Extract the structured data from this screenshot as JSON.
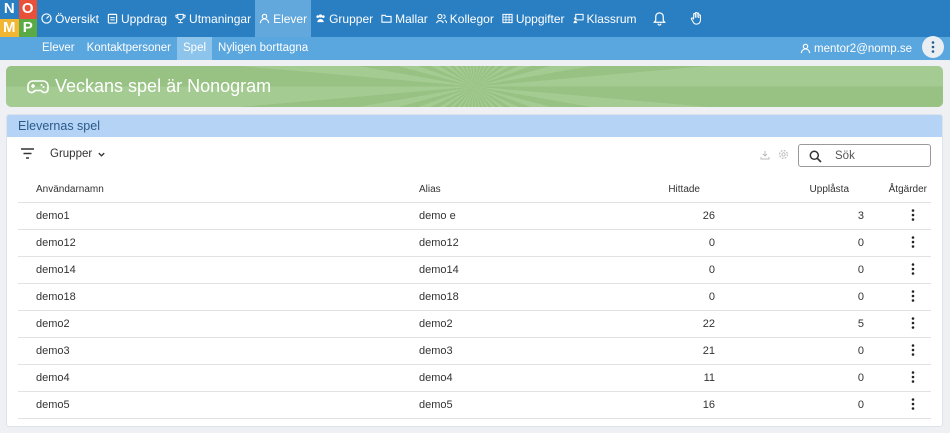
{
  "logo": {
    "letters": [
      "N",
      "O",
      "M",
      "P"
    ]
  },
  "nav": {
    "items": [
      {
        "label": "Översikt",
        "icon": "gauge-icon",
        "active": false
      },
      {
        "label": "Uppdrag",
        "icon": "clipboard-icon",
        "active": false
      },
      {
        "label": "Utmaningar",
        "icon": "trophy-icon",
        "active": false
      },
      {
        "label": "Elever",
        "icon": "user-icon",
        "active": true
      },
      {
        "label": "Grupper",
        "icon": "users-icon",
        "active": false
      },
      {
        "label": "Mallar",
        "icon": "folder-icon",
        "active": false
      },
      {
        "label": "Kollegor",
        "icon": "colleagues-icon",
        "active": false
      },
      {
        "label": "Uppgifter",
        "icon": "grid-icon",
        "active": false
      },
      {
        "label": "Klassrum",
        "icon": "classroom-icon",
        "active": false
      }
    ]
  },
  "subnav": {
    "items": [
      {
        "label": "Elever",
        "active": false
      },
      {
        "label": "Kontaktpersoner",
        "active": false
      },
      {
        "label": "Spel",
        "active": true
      },
      {
        "label": "Nyligen borttagna",
        "active": false
      }
    ],
    "user": "mentor2@nomp.se"
  },
  "banner": {
    "title": "Veckans spel är Nonogram"
  },
  "panel": {
    "title": "Elevernas spel",
    "groups_label": "Grupper",
    "search_placeholder": "Sök",
    "columns": {
      "username": "Användarnamn",
      "alias": "Alias",
      "found": "Hittade",
      "solved": "Upplåsta",
      "actions": "Åtgärder"
    },
    "rows": [
      {
        "username": "demo1",
        "alias": "demo e",
        "found": "26",
        "solved": "3"
      },
      {
        "username": "demo12",
        "alias": "demo12",
        "found": "0",
        "solved": "0"
      },
      {
        "username": "demo14",
        "alias": "demo14",
        "found": "0",
        "solved": "0"
      },
      {
        "username": "demo18",
        "alias": "demo18",
        "found": "0",
        "solved": "0"
      },
      {
        "username": "demo2",
        "alias": "demo2",
        "found": "22",
        "solved": "5"
      },
      {
        "username": "demo3",
        "alias": "demo3",
        "found": "21",
        "solved": "0"
      },
      {
        "username": "demo4",
        "alias": "demo4",
        "found": "11",
        "solved": "0"
      },
      {
        "username": "demo5",
        "alias": "demo5",
        "found": "16",
        "solved": "0"
      }
    ]
  },
  "colors": {
    "nav_bg": "#2a7fc3",
    "nav_active": "#62a8dc",
    "subnav_bg": "#5aa6df",
    "subnav_active": "#8cc4ec",
    "banner_green": "#97c284",
    "panel_header": "#b5d4f5"
  }
}
